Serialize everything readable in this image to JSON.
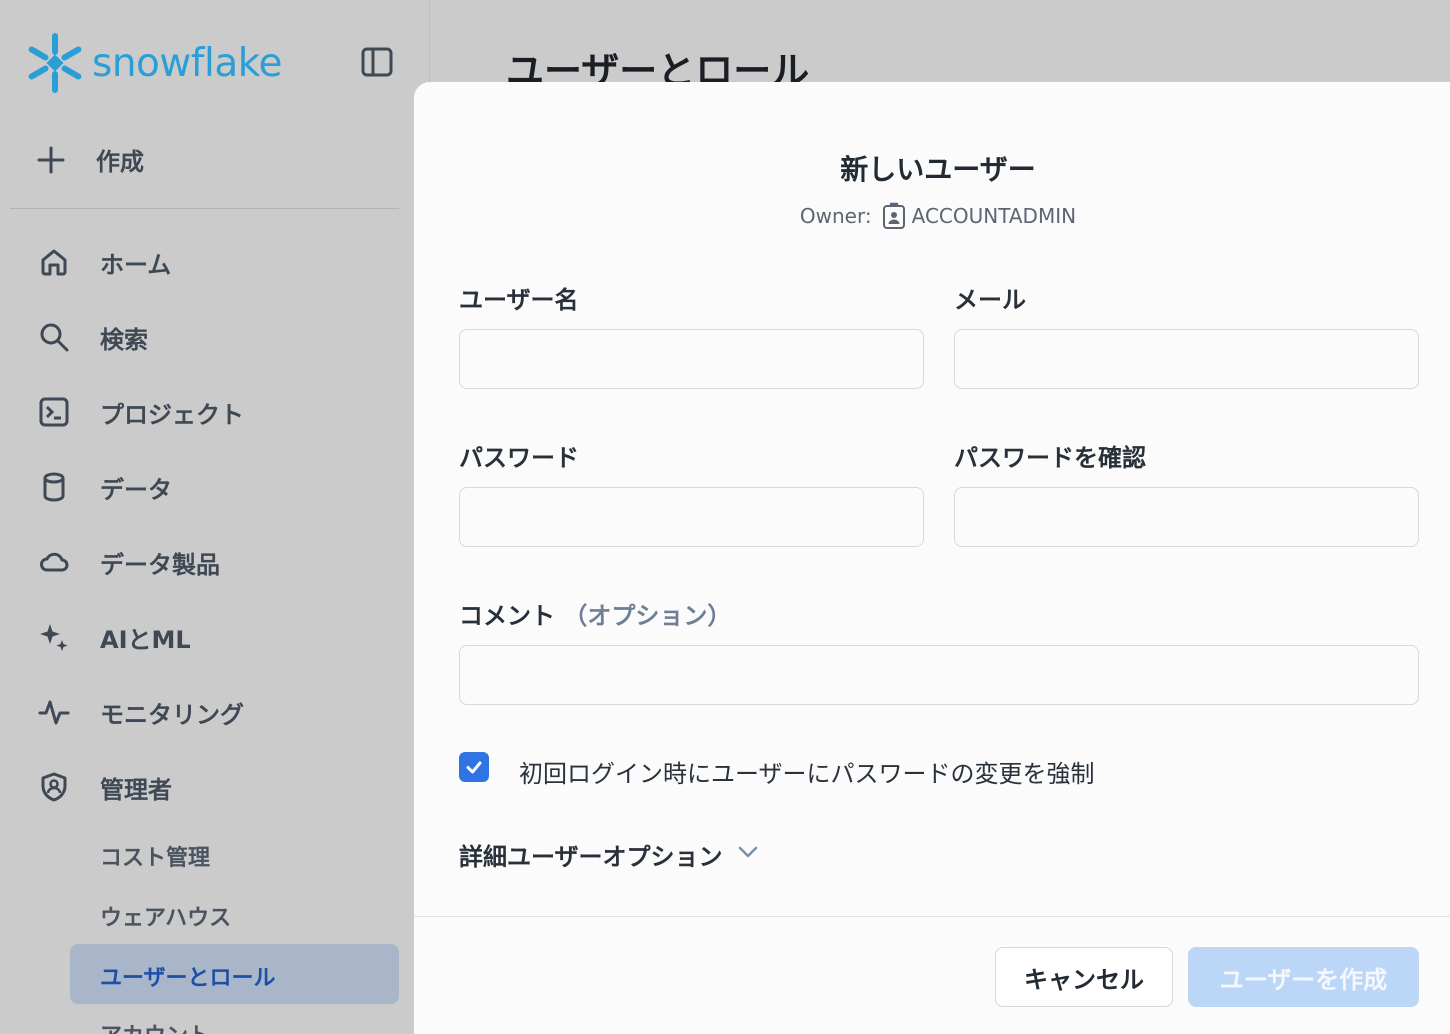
{
  "brand": {
    "name": "snowflake",
    "color": "#2a9fd6"
  },
  "sidebar": {
    "create_label": "作成",
    "items": [
      {
        "label": "ホーム",
        "icon": "home-icon"
      },
      {
        "label": "検索",
        "icon": "search-icon"
      },
      {
        "label": "プロジェクト",
        "icon": "terminal-icon"
      },
      {
        "label": "データ",
        "icon": "database-icon"
      },
      {
        "label": "データ製品",
        "icon": "cloud-icon"
      },
      {
        "label": "AIとML",
        "icon": "sparkle-icon"
      },
      {
        "label": "モニタリング",
        "icon": "activity-icon"
      },
      {
        "label": "管理者",
        "icon": "shield-user-icon"
      }
    ],
    "admin_sub": [
      {
        "label": "コスト管理"
      },
      {
        "label": "ウェアハウス"
      },
      {
        "label": "ユーザーとロール",
        "active": true
      },
      {
        "label": "アカウント"
      }
    ]
  },
  "page": {
    "title": "ユーザーとロール"
  },
  "modal": {
    "title": "新しいユーザー",
    "owner_prefix": "Owner:",
    "owner_value": "ACCOUNTADMIN",
    "fields": {
      "username": {
        "label": "ユーザー名",
        "value": ""
      },
      "email": {
        "label": "メール",
        "value": ""
      },
      "password": {
        "label": "パスワード",
        "value": ""
      },
      "password_confirm": {
        "label": "パスワードを確認",
        "value": ""
      },
      "comment": {
        "label": "コメント",
        "optional": "（オプション）",
        "value": ""
      }
    },
    "force_password_change": {
      "label": "初回ログイン時にユーザーにパスワードの変更を強制",
      "checked": true
    },
    "advanced_label": "詳細ユーザーオプション",
    "cancel_label": "キャンセル",
    "create_label": "ユーザーを作成"
  },
  "colors": {
    "accent": "#2f74e2",
    "disabled_button": "#bcd6f7",
    "active_nav": "#1d4fa8"
  }
}
